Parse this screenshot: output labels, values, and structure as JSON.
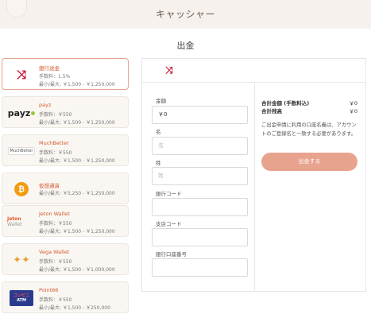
{
  "header": {
    "title": "キャッシャー"
  },
  "section_title": "出金",
  "methods": [
    {
      "icon": "shuffle-icon",
      "name": "銀行送金",
      "fee": "手数料：1.5%",
      "range": "最小/最大: ￥1,500 - ￥1,250,000",
      "active": true
    },
    {
      "icon": "payz-logo",
      "logo_text": "payz",
      "name": "payz",
      "fee": "手数料：￥550",
      "range": "最小/最大: ￥1,500 - ￥1,250,000"
    },
    {
      "icon": "muchbetter-logo",
      "logo_text": "MuchBetter",
      "name": "MuchBetter",
      "fee": "手数料：￥550",
      "range": "最小/最大: ￥1,500 - ￥1,250,000"
    },
    {
      "icon": "bitcoin-icon",
      "name": "仮想通貨",
      "fee": "最小/最大: ￥5,250 - ￥1,250,000"
    },
    {
      "icon": "jeton-logo",
      "logo_text": "Jeton",
      "logo_suffix": "Wallet",
      "name": "Jeton Wallet",
      "fee": "手数料：￥550",
      "range": "最小/最大: ￥1,500 - ￥1,250,000"
    },
    {
      "icon": "vega-logo",
      "name": "Vega Wallet",
      "fee": "手数料：￥550",
      "range": "最小/最大: ￥1,500 - ￥1,000,000"
    },
    {
      "icon": "point66-logo",
      "logo_line1": "コンビニ",
      "logo_line2": "ATM",
      "name": "Point66",
      "fee": "手数料：￥550",
      "range": "最小/最大: ￥1,500 - ￥250,000"
    }
  ],
  "form": {
    "amount_label": "金額",
    "amount_value": "￥0",
    "given_name_label": "名",
    "given_name_placeholder": "名",
    "family_name_label": "姓",
    "family_name_placeholder": "姓",
    "bank_code_label": "銀行コード",
    "branch_code_label": "支店コード",
    "account_number_label": "銀行口座番号"
  },
  "summary": {
    "total_label": "合計金額 (手数料込)",
    "total_value": "￥0",
    "balance_label": "合計残高",
    "balance_value": "￥0",
    "note": "ご出金申請に利用の口座名義は、アカウントのご登録名と一致する必要があります。",
    "submit_label": "出金する"
  },
  "colors": {
    "accent": "#d2592c",
    "submit": "#e8a38e",
    "topbar": "#f6f1ec"
  }
}
